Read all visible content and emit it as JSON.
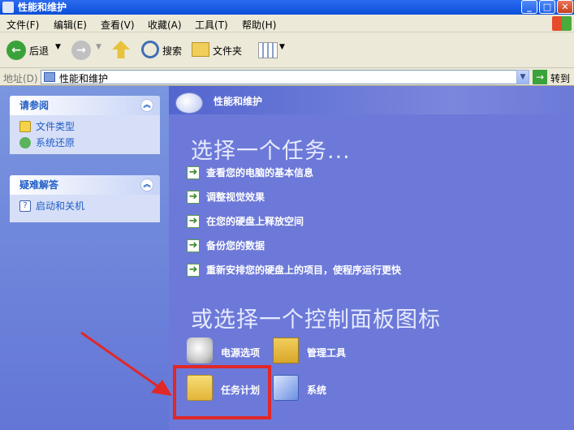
{
  "window": {
    "title": "性能和维护"
  },
  "menu": [
    "文件(F)",
    "编辑(E)",
    "查看(V)",
    "收藏(A)",
    "工具(T)",
    "帮助(H)"
  ],
  "toolbar": {
    "back": "后退",
    "search": "搜索",
    "folders": "文件夹"
  },
  "address": {
    "label": "地址(D)",
    "value": "性能和维护",
    "go": "转到"
  },
  "sidebar": {
    "see_also": {
      "title": "请参阅",
      "items": [
        "文件类型",
        "系统还原"
      ]
    },
    "troubleshoot": {
      "title": "疑难解答",
      "items": [
        "启动和关机"
      ]
    }
  },
  "main": {
    "header": "性能和维护",
    "pick_task": "选择一个任务...",
    "tasks": [
      "查看您的电脑的基本信息",
      "调整视觉效果",
      "在您的硬盘上释放空间",
      "备份您的数据",
      "重新安排您的硬盘上的项目，使程序运行更快"
    ],
    "or_pick": "或选择一个控制面板图标",
    "icons": [
      "电源选项",
      "管理工具",
      "任务计划",
      "系统"
    ]
  },
  "colors": {
    "highlight": "#e02828",
    "accent": "#215dc6"
  }
}
